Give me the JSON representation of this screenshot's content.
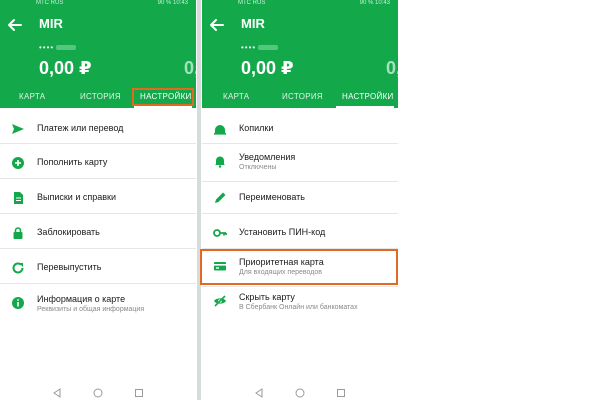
{
  "colors": {
    "brand_green": "#13a94b",
    "highlight": "#e06a1f",
    "icon_green": "#13a94b"
  },
  "phones": [
    {
      "status_carrier": "МТС RUS",
      "status_battery": "90 % 10:43",
      "title": "MIR",
      "card_number": "••••",
      "balance": "0,00 ₽",
      "balance_next": "0,",
      "tabs": [
        "КАРТА",
        "ИСТОРИЯ",
        "НАСТРОЙКИ"
      ],
      "active_tab": "НАСТРОЙКИ",
      "items": [
        {
          "icon": "send-icon",
          "label": "Платеж или перевод"
        },
        {
          "icon": "add-circle-icon",
          "label": "Пополнить карту"
        },
        {
          "icon": "document-icon",
          "label": "Выписки и справки"
        },
        {
          "icon": "lock-icon",
          "label": "Заблокировать"
        },
        {
          "icon": "refresh-icon",
          "label": "Перевыпустить"
        },
        {
          "icon": "info-icon",
          "label": "Информация о карте",
          "sub": "Реквизиты и общая информация"
        }
      ]
    },
    {
      "status_carrier": "МТС RUS",
      "status_battery": "90 % 10:43",
      "title": "MIR",
      "card_number": "••••",
      "balance": "0,00 ₽",
      "balance_next": "0,",
      "tabs": [
        "КАРТА",
        "ИСТОРИЯ",
        "НАСТРОЙКИ"
      ],
      "active_tab": "НАСТРОЙКИ",
      "items": [
        {
          "icon": "piggy-bank-icon",
          "label": "Копилки"
        },
        {
          "icon": "bell-icon",
          "label": "Уведомления",
          "sub": "Отключены"
        },
        {
          "icon": "pencil-icon",
          "label": "Переименовать"
        },
        {
          "icon": "key-icon",
          "label": "Установить ПИН-код"
        },
        {
          "icon": "card-priority-icon",
          "label": "Приоритетная карта",
          "sub": "Для входящих переводов"
        },
        {
          "icon": "eye-off-icon",
          "label": "Скрыть карту",
          "sub": "В Сбербанк Онлайн или банкоматах"
        }
      ]
    }
  ]
}
